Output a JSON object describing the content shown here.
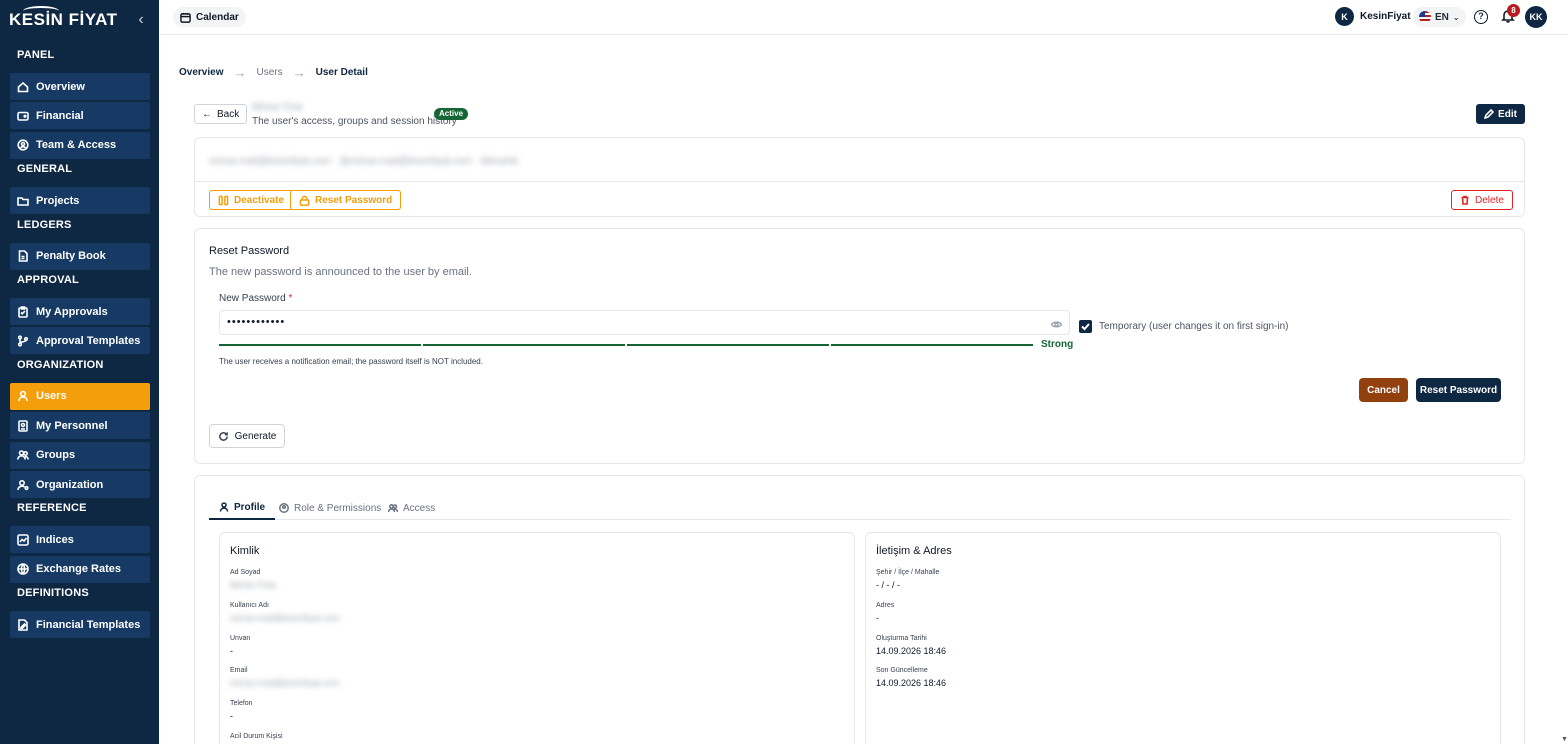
{
  "sidebar": {
    "logo": "KESİN FİYAT",
    "collapse_icon": "chevron-left-icon",
    "sections": [
      {
        "title": "PANEL",
        "items": [
          {
            "label": "Overview",
            "icon": "home-icon"
          },
          {
            "label": "Financial",
            "icon": "wallet-icon"
          },
          {
            "label": "Team & Access",
            "icon": "shield-user-icon"
          }
        ]
      },
      {
        "title": "GENERAL",
        "items": [
          {
            "label": "Projects",
            "icon": "folder-icon"
          }
        ]
      },
      {
        "title": "LEDGERS",
        "items": [
          {
            "label": "Penalty Book",
            "icon": "file-icon"
          }
        ]
      },
      {
        "title": "APPROVAL",
        "items": [
          {
            "label": "My Approvals",
            "icon": "clipboard-icon"
          },
          {
            "label": "Approval Templates",
            "icon": "branch-icon"
          }
        ]
      },
      {
        "title": "ORGANIZATION",
        "items": [
          {
            "label": "Users",
            "icon": "user-icon",
            "active": true
          },
          {
            "label": "My Personnel",
            "icon": "id-card-icon"
          },
          {
            "label": "Groups",
            "icon": "users-icon"
          },
          {
            "label": "Organization",
            "icon": "user-cog-icon"
          }
        ]
      },
      {
        "title": "REFERENCE",
        "items": [
          {
            "label": "Indices",
            "icon": "chart-icon"
          },
          {
            "label": "Exchange Rates",
            "icon": "globe-icon"
          }
        ]
      },
      {
        "title": "DEFINITIONS",
        "items": [
          {
            "label": "Financial Templates",
            "icon": "edit-doc-icon"
          }
        ]
      }
    ]
  },
  "topbar": {
    "calendar_label": "Calendar",
    "user_initial": "K",
    "user_name": "KesinFiyat",
    "language": "EN",
    "notification_count": "8",
    "avatar_initials": "KK"
  },
  "breadcrumb": {
    "items": [
      "Overview",
      "Users",
      "User Detail"
    ]
  },
  "header": {
    "back_label": "Back",
    "user_name": "Mimar Firat",
    "subtitle": "The user's access, groups and session history",
    "status": "Active",
    "edit_label": "Edit"
  },
  "account": {
    "meta": "mimar.mail@kesinfiyat.com · @mimar.mail@kesinfiyat.com · Mimarlık",
    "deactivate_label": "Deactivate",
    "reset_password_label": "Reset Password",
    "delete_label": "Delete"
  },
  "reset_password": {
    "title": "Reset Password",
    "subtitle": "The new password is announced to the user by email.",
    "field_label": "New Password",
    "required_mark": "*",
    "value": "••••••••••••",
    "strength": "Strong",
    "strength_level": 4,
    "temporary_label": "Temporary (user changes it on first sign-in)",
    "temporary_checked": true,
    "hint": "The user receives a notification email; the password itself is NOT included.",
    "cancel_label": "Cancel",
    "submit_label": "Reset Password",
    "generate_label": "Generate"
  },
  "tabs": [
    {
      "label": "Profile",
      "active": true,
      "icon": "user-icon"
    },
    {
      "label": "Role & Permissions",
      "active": false,
      "icon": "shield-user-icon"
    },
    {
      "label": "Access",
      "active": false,
      "icon": "users-icon"
    }
  ],
  "profile": {
    "identity": {
      "title": "Kimlik",
      "fields": [
        {
          "label": "Ad Soyad",
          "value": "Mimar Firat",
          "hidden": true
        },
        {
          "label": "Kullanıcı Adı",
          "value": "mimar.mail@kesinfiyat.com",
          "hidden": true
        },
        {
          "label": "Unvan",
          "value": "-"
        },
        {
          "label": "Email",
          "value": "mimar.mail@kesinfiyat.com",
          "hidden": true
        },
        {
          "label": "Telefon",
          "value": "-"
        },
        {
          "label": "Acil Durum Kişisi",
          "value": ""
        }
      ]
    },
    "contact": {
      "title": "İletişim & Adres",
      "fields": [
        {
          "label": "Şehir / İlçe / Mahalle",
          "value": "- / - / -"
        },
        {
          "label": "Adres",
          "value": "-"
        },
        {
          "label": "Oluşturma Tarihi",
          "value": "14.09.2026 18:46"
        },
        {
          "label": "Son Güncelleme",
          "value": "14.09.2026 18:46"
        }
      ]
    }
  }
}
